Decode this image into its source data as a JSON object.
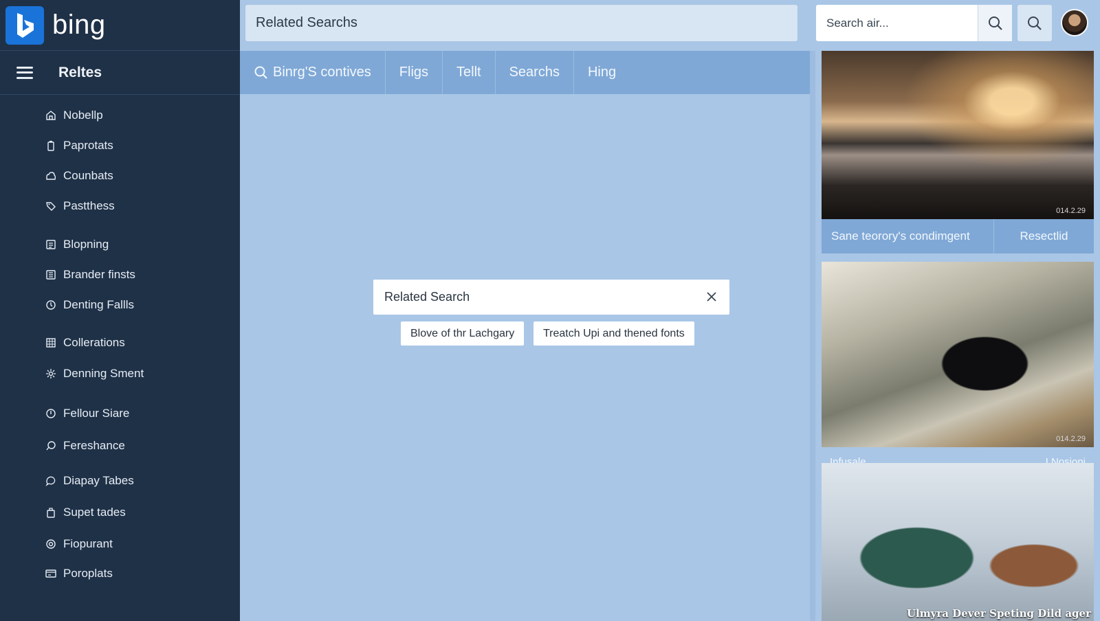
{
  "brand": {
    "name": "bing"
  },
  "sidebar": {
    "title": "Reltes",
    "items": [
      {
        "label": "Nobellp",
        "icon": "home-icon"
      },
      {
        "label": "Paprotats",
        "icon": "battery-icon"
      },
      {
        "label": "Counbats",
        "icon": "cloud-icon"
      },
      {
        "label": "Pastthess",
        "icon": "tag-icon"
      },
      {
        "label": "Blopning",
        "icon": "document-icon"
      },
      {
        "label": "Brander finsts",
        "icon": "list-icon"
      },
      {
        "label": "Denting Fallls",
        "icon": "clock-icon"
      },
      {
        "label": "Collerations",
        "icon": "grid-icon"
      },
      {
        "label": "Denning Sment",
        "icon": "settings-icon"
      },
      {
        "label": "Fellour Siare",
        "icon": "clock-icon"
      },
      {
        "label": "Fereshance",
        "icon": "chat-icon"
      },
      {
        "label": "Diapay Tabes",
        "icon": "chat-bubble-icon"
      },
      {
        "label": "Supet tades",
        "icon": "bag-icon"
      },
      {
        "label": "Fiopurant",
        "icon": "target-icon"
      },
      {
        "label": "Poroplats",
        "icon": "card-icon"
      }
    ]
  },
  "header": {
    "search_value": "Related Searchs",
    "side_search_placeholder": "Search air..."
  },
  "tabs": [
    {
      "label": "Binrg'S contives",
      "icon": "search-icon"
    },
    {
      "label": "Fligs"
    },
    {
      "label": "Tellt"
    },
    {
      "label": "Searchs"
    },
    {
      "label": "Hing"
    }
  ],
  "related": {
    "title": "Related Search",
    "chips": [
      "Blove of thr Lachgary",
      "Treatch Upi and thened fonts"
    ]
  },
  "cards": [
    {
      "stamp": "014.2.29",
      "title": "Sane teorory's condimgent",
      "action": "Resectlid"
    },
    {
      "stamp": "014.2.29",
      "peek_left": "Infusale",
      "peek_right": "I Nosioni"
    },
    {
      "caption": "Ulmyra Dever Speting Dild ager"
    }
  ],
  "colors": {
    "sidebar_bg": "#1f3147",
    "page_bg": "#a9c6e6",
    "tab_bar": "#7fa8d6",
    "brand_blue": "#1a73d9"
  }
}
